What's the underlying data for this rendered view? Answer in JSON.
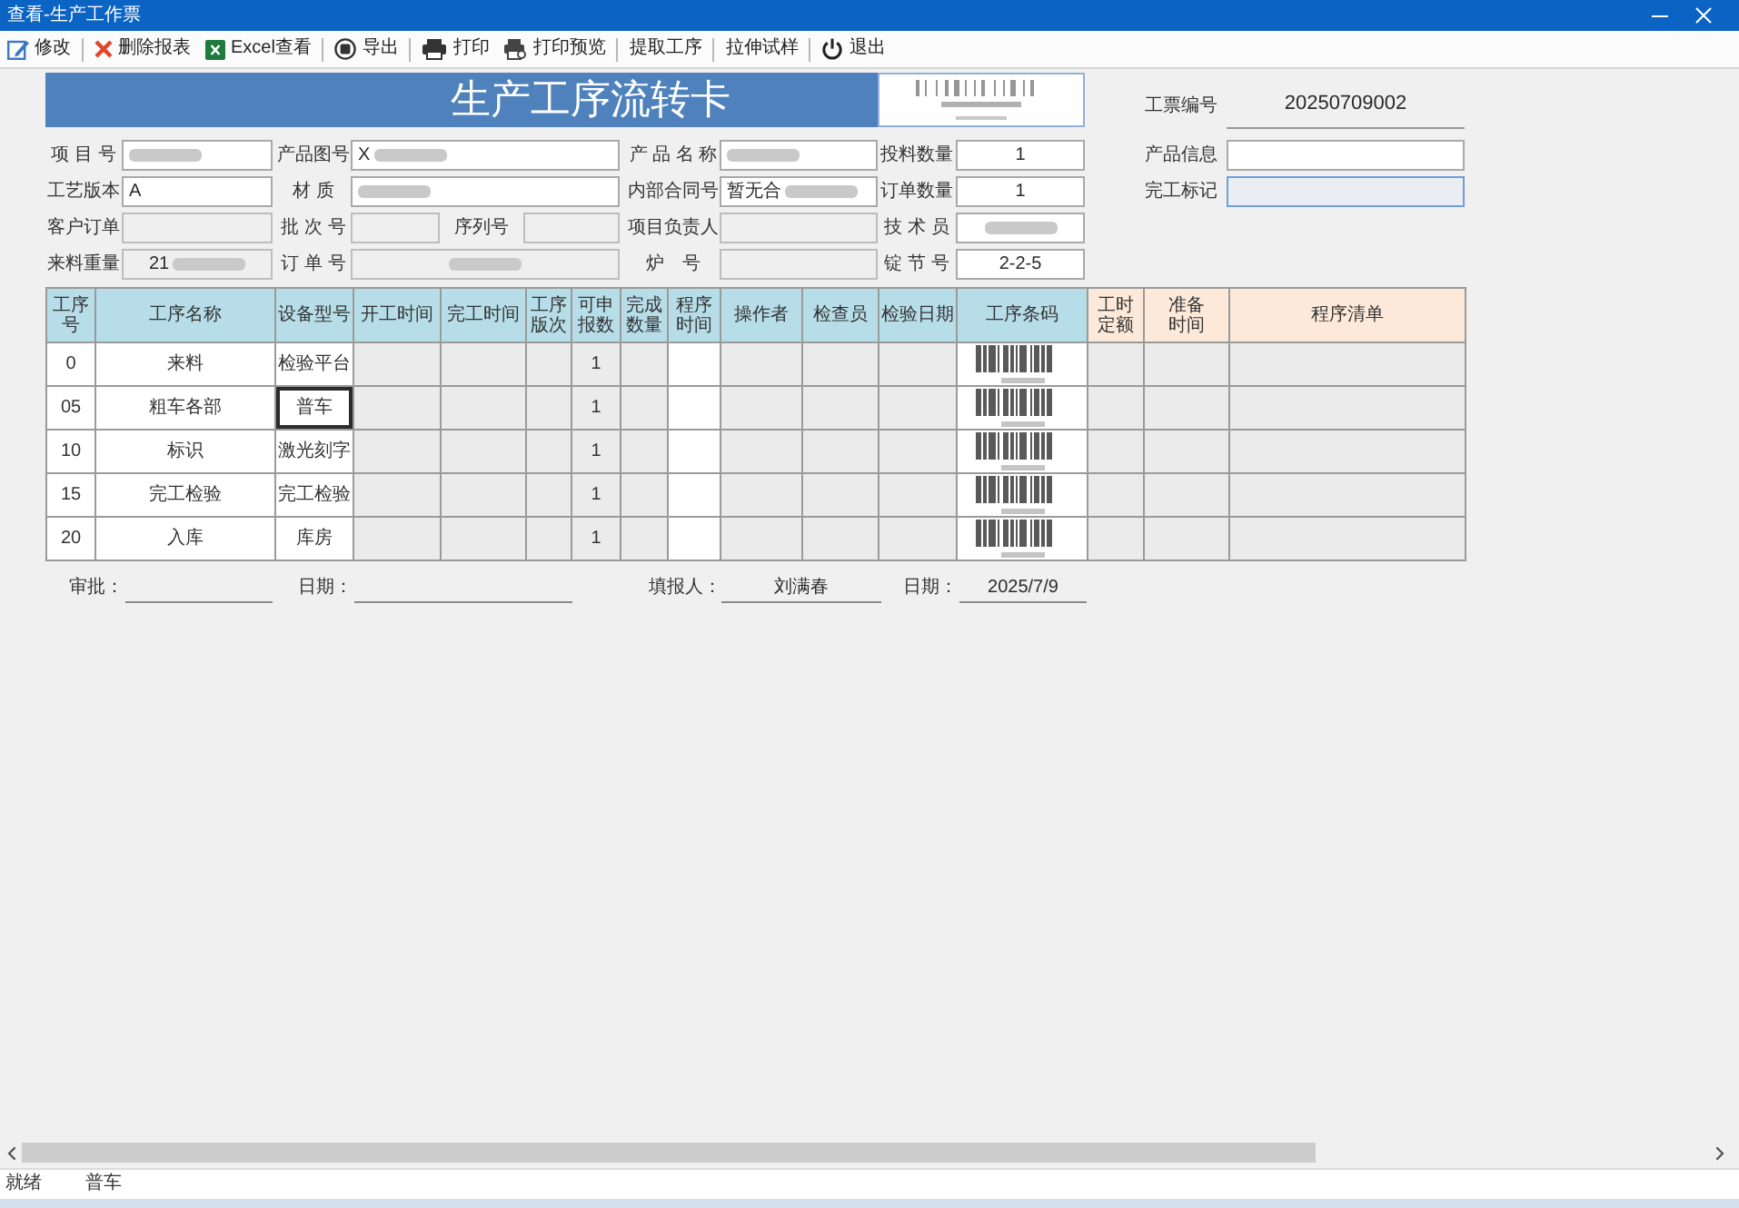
{
  "window": {
    "title": "查看-生产工作票"
  },
  "toolbar": [
    {
      "label": "修改",
      "kind": "edit",
      "separator_after": true
    },
    {
      "label": "删除报表",
      "kind": "delete",
      "separator_after": false
    },
    {
      "label": "Excel查看",
      "kind": "excel",
      "separator_after": true
    },
    {
      "label": "导出",
      "kind": "export",
      "separator_after": true
    },
    {
      "label": "打印",
      "kind": "print",
      "separator_after": false
    },
    {
      "label": "打印预览",
      "kind": "preview",
      "separator_after": true
    },
    {
      "label": "提取工序",
      "kind": "plain",
      "separator_after": true
    },
    {
      "label": "拉伸试样",
      "kind": "plain",
      "separator_after": true
    },
    {
      "label": "退出",
      "kind": "exit",
      "separator_after": false
    }
  ],
  "card": {
    "title": "生产工序流转卡",
    "ticket_label": "工票编号",
    "ticket_number": "20250709002"
  },
  "form": {
    "rows": [
      [
        {
          "label": "项 目 号",
          "blurred": true,
          "disabled": false
        },
        {
          "label": "产品图号",
          "value": "X",
          "blurred": true,
          "disabled": false
        },
        {
          "label": "产 品 名 称",
          "blurred": true,
          "disabled": false
        },
        {
          "label": "投料数量",
          "value": "1",
          "blurred": false,
          "disabled": false
        }
      ],
      [
        {
          "label": "工艺版本",
          "value": "A",
          "blurred": false,
          "disabled": false
        },
        {
          "label": "材 质",
          "blurred": true,
          "disabled": false
        },
        {
          "label": "内部合同号",
          "value": "暂无合",
          "blurred": true,
          "disabled": false
        },
        {
          "label": "订单数量",
          "value": "1",
          "blurred": false,
          "disabled": false
        }
      ],
      [
        {
          "label": "客户订单",
          "blurred": false,
          "disabled": true
        },
        {
          "label": "批 次 号",
          "blurred": false,
          "disabled": true,
          "sub_field": {
            "label": "序列号",
            "blurred": false,
            "disabled": true
          }
        },
        {
          "label": "项目负责人",
          "blurred": false,
          "disabled": true
        },
        {
          "label": "技 术 员",
          "blurred": true,
          "disabled": false
        }
      ],
      [
        {
          "label": "来料重量",
          "value": "21",
          "blurred": true,
          "disabled": true
        },
        {
          "label": "订 单 号",
          "blurred": true,
          "disabled": true
        },
        {
          "label": "炉　号",
          "blurred": false,
          "disabled": true
        },
        {
          "label": "锭 节 号",
          "value": "2-2-5",
          "blurred": false,
          "disabled": false
        }
      ]
    ]
  },
  "info_fields": [
    {
      "label": "产品信息",
      "disabled": false,
      "focused": false
    },
    {
      "label": "完工标记",
      "disabled": true,
      "focused": true
    }
  ],
  "table": {
    "columns": [
      {
        "label": "工序号",
        "color": "#b7dde8",
        "kind": "step",
        "shaded": false
      },
      {
        "label": "工序名称",
        "color": "#b7dde8",
        "kind": "name",
        "shaded": false
      },
      {
        "label": "设备型号",
        "color": "#b7dde8",
        "kind": "equipment",
        "shaded": false
      },
      {
        "label": "开工时间",
        "color": "#b7dde8",
        "kind": "blank",
        "shaded": true
      },
      {
        "label": "完工时间",
        "color": "#b7dde8",
        "kind": "blank",
        "shaded": true
      },
      {
        "label": "工序版次",
        "color": "#b7dde8",
        "kind": "blank",
        "shaded": true
      },
      {
        "label": "可申报数",
        "color": "#b7dde8",
        "kind": "reportable",
        "shaded": true
      },
      {
        "label": "完成数量",
        "color": "#b7dde8",
        "kind": "blank",
        "shaded": true
      },
      {
        "label": "程序时间",
        "color": "#b7dde8",
        "kind": "blank",
        "shaded": false
      },
      {
        "label": "操作者",
        "color": "#b7dde8",
        "kind": "blank",
        "shaded": true
      },
      {
        "label": "检查员",
        "color": "#b7dde8",
        "kind": "blank",
        "shaded": true
      },
      {
        "label": "检验日期",
        "color": "#b7dde8",
        "kind": "blank",
        "shaded": true
      },
      {
        "label": "工序条码",
        "color": "#b7dde8",
        "kind": "barcode",
        "shaded": false
      },
      {
        "label": "工时定额",
        "color": "#fde9d9",
        "kind": "blank",
        "shaded": true
      },
      {
        "label": "准备时间",
        "color": "#fde9d9",
        "kind": "blank",
        "shaded": true
      },
      {
        "label": "程序清单",
        "color": "#fde9d9",
        "kind": "blank",
        "shaded": true
      }
    ],
    "rows": [
      {
        "step": "0",
        "name": "来料",
        "equipment": "检验平台",
        "reportable": "1",
        "selected": false
      },
      {
        "step": "05",
        "name": "粗车各部",
        "equipment": "普车",
        "reportable": "1",
        "selected": true
      },
      {
        "step": "10",
        "name": "标识",
        "equipment": "激光刻字",
        "reportable": "1",
        "selected": false
      },
      {
        "step": "15",
        "name": "完工检验",
        "equipment": "完工检验",
        "reportable": "1",
        "selected": false
      },
      {
        "step": "20",
        "name": "入库",
        "equipment": "库房",
        "reportable": "1",
        "selected": false
      }
    ]
  },
  "signatures": [
    {
      "label": "审批："
    },
    {
      "label": "日期："
    },
    {
      "label": "填报人：",
      "value": "刘满春"
    },
    {
      "label": "日期：",
      "value": "2025/7/9"
    }
  ],
  "status_bar": [
    "就绪",
    "普车"
  ]
}
